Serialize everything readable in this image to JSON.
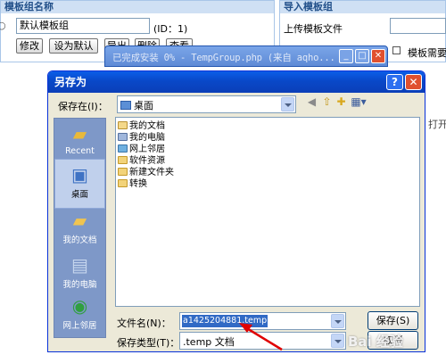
{
  "background": {
    "panel_left_title": "模板组名称",
    "template_name_value": "默认模板组",
    "template_id_label": "(ID：1)",
    "btn_edit": "修改",
    "btn_set_default": "设为默认",
    "btn_export": "导出",
    "btn_delete": "删除",
    "btn_view": "查看",
    "panel_right_title": "导入模板组",
    "upload_label": "上传模板文件",
    "checkbox_label": "模板需要",
    "cut_text": "打开",
    "radio_mark": "○"
  },
  "progress_window": {
    "title": "已完成安装 0% - TempGroup.php (来自 aqho..."
  },
  "dialog": {
    "title": "另存为",
    "help_glyph": "?",
    "close_glyph": "✕",
    "save_in_label": "保存在(I)：",
    "save_in_value": "桌面",
    "places": [
      {
        "label": "Recent",
        "icon": "recent-icon"
      },
      {
        "label": "桌面",
        "icon": "desktop-icon"
      },
      {
        "label": "我的文档",
        "icon": "my-documents-icon"
      },
      {
        "label": "我的电脑",
        "icon": "my-computer-icon"
      },
      {
        "label": "网上邻居",
        "icon": "network-icon"
      }
    ],
    "files": [
      {
        "name": "我的文档",
        "kind": "doc"
      },
      {
        "name": "我的电脑",
        "kind": "pc"
      },
      {
        "name": "网上邻居",
        "kind": "net"
      },
      {
        "name": "软件资源",
        "kind": "fold"
      },
      {
        "name": "新建文件夹",
        "kind": "fold"
      },
      {
        "name": "转换",
        "kind": "fold"
      }
    ],
    "filename_label": "文件名(N)：",
    "filename_value": "a1425204881.temp",
    "filetype_label": "保存类型(T)：",
    "filetype_value": ".temp 文档",
    "save_button": "保存(S)",
    "cancel_button": "取消"
  },
  "watermark": "Bai 经验"
}
